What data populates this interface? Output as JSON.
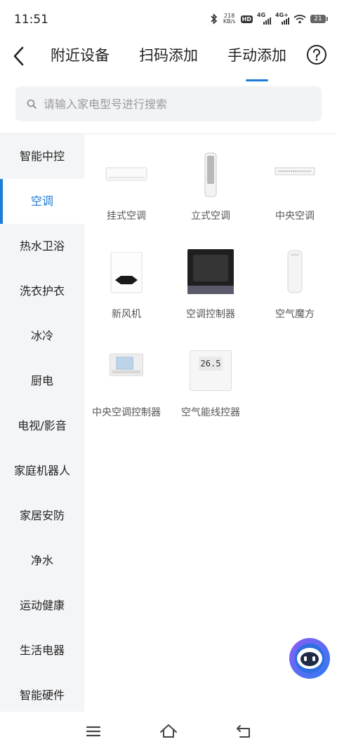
{
  "status": {
    "time": "11:51",
    "speed_value": "218",
    "speed_unit": "KB/s",
    "hd": "HD",
    "net1": "4G",
    "net2": "4G+",
    "battery": "21"
  },
  "header": {
    "tabs": [
      {
        "label": "附近设备"
      },
      {
        "label": "扫码添加"
      },
      {
        "label": "手动添加"
      }
    ],
    "active_tab": "手动添加"
  },
  "search": {
    "placeholder": "请输入家电型号进行搜索"
  },
  "sidebar": {
    "items": [
      {
        "label": "智能中控"
      },
      {
        "label": "空调"
      },
      {
        "label": "热水卫浴"
      },
      {
        "label": "洗衣护衣"
      },
      {
        "label": "冰冷"
      },
      {
        "label": "厨电"
      },
      {
        "label": "电视/影音"
      },
      {
        "label": "家庭机器人"
      },
      {
        "label": "家居安防"
      },
      {
        "label": "净水"
      },
      {
        "label": "运动健康"
      },
      {
        "label": "生活电器"
      },
      {
        "label": "智能硬件"
      }
    ],
    "active": "空调"
  },
  "products": [
    {
      "label": "挂式空调"
    },
    {
      "label": "立式空调"
    },
    {
      "label": "中央空调"
    },
    {
      "label": "新风机"
    },
    {
      "label": "空调控制器"
    },
    {
      "label": "空气魔方"
    },
    {
      "label": "中央空调控制器"
    },
    {
      "label": "空气能线控器",
      "display": "26.5"
    }
  ],
  "colors": {
    "accent": "#1c7cd6",
    "sidebar_bg": "#f4f5f7"
  }
}
